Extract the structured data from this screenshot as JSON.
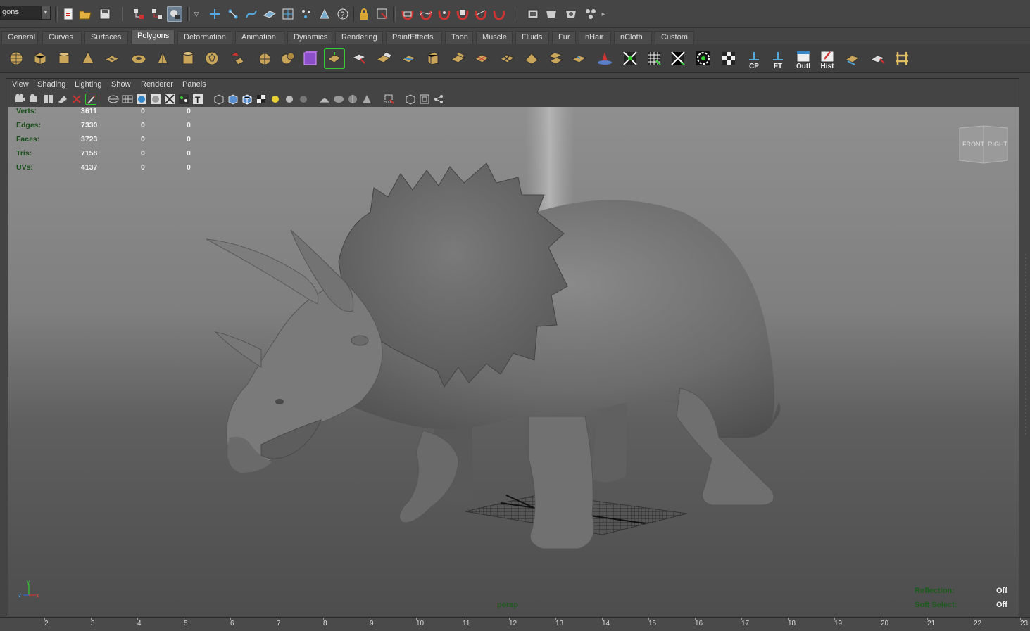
{
  "status_line": {
    "mode_selector": "gons"
  },
  "shelf_tabs": [
    "General",
    "Curves",
    "Surfaces",
    "Polygons",
    "Deformation",
    "Animation",
    "Dynamics",
    "Rendering",
    "PaintEffects",
    "Toon",
    "Muscle",
    "Fluids",
    "Fur",
    "nHair",
    "nCloth",
    "Custom"
  ],
  "active_tab": "Polygons",
  "shelf_labels": {
    "cp": "CP",
    "ft": "FT",
    "outliner": "Outl",
    "history": "Hist"
  },
  "panel_menu": [
    "View",
    "Shading",
    "Lighting",
    "Show",
    "Renderer",
    "Panels"
  ],
  "hud": {
    "rows": [
      {
        "label": "Verts:",
        "v1": "3611",
        "v2": "0",
        "v3": "0"
      },
      {
        "label": "Edges:",
        "v1": "7330",
        "v2": "0",
        "v3": "0"
      },
      {
        "label": "Faces:",
        "v1": "3723",
        "v2": "0",
        "v3": "0"
      },
      {
        "label": "Tris:",
        "v1": "7158",
        "v2": "0",
        "v3": "0"
      },
      {
        "label": "UVs:",
        "v1": "4137",
        "v2": "0",
        "v3": "0"
      }
    ],
    "camera": "persp",
    "reflection_label": "Reflection:",
    "reflection_value": "Off",
    "soft_select_label": "Soft Select:",
    "soft_select_value": "Off"
  },
  "viewcube": {
    "front": "FRONT",
    "right": "RIGHT"
  },
  "axis": {
    "y": "y",
    "z": "z",
    "x": "x"
  },
  "timeline_ticks": [
    "2",
    "3",
    "4",
    "5",
    "6",
    "7",
    "8",
    "9",
    "10",
    "11",
    "12",
    "13",
    "14",
    "15",
    "16",
    "17",
    "18",
    "19",
    "20",
    "21",
    "22",
    "23"
  ],
  "colors": {
    "hud_label": "#1b4f1b",
    "hud_value": "#f2f2f2",
    "viewport_top": "#8f8f8f",
    "viewport_bottom": "#4d4d4d"
  }
}
